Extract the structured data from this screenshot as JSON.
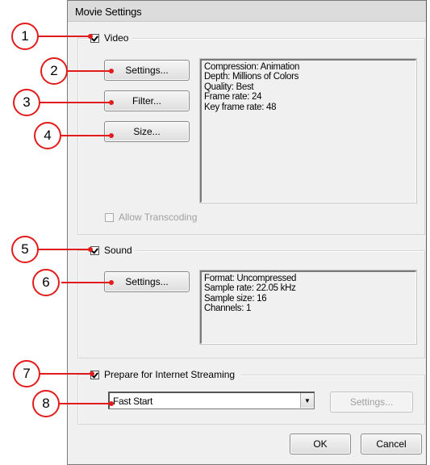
{
  "dialog": {
    "title": "Movie Settings",
    "ok_label": "OK",
    "cancel_label": "Cancel"
  },
  "video": {
    "label": "Video",
    "checked": true,
    "buttons": {
      "settings": "Settings...",
      "filter": "Filter...",
      "size": "Size..."
    },
    "info": [
      "Compression: Animation",
      "Depth: Millions of Colors",
      "Quality: Best",
      "Frame rate: 24",
      "Key frame rate: 48"
    ],
    "allow_transcoding_label": "Allow Transcoding",
    "allow_transcoding_enabled": false
  },
  "sound": {
    "label": "Sound",
    "checked": true,
    "settings_label": "Settings...",
    "info": [
      "Format: Uncompressed",
      "Sample rate: 22.05 kHz",
      "Sample size: 16",
      "Channels: 1"
    ]
  },
  "streaming": {
    "label": "Prepare for Internet Streaming",
    "checked": true,
    "selected": "Fast Start",
    "settings_label": "Settings..."
  },
  "callouts": [
    "1",
    "2",
    "3",
    "4",
    "5",
    "6",
    "7",
    "8"
  ],
  "colors": {
    "callout": "#e21c1c",
    "dialog_bg": "#f0f0f0"
  }
}
